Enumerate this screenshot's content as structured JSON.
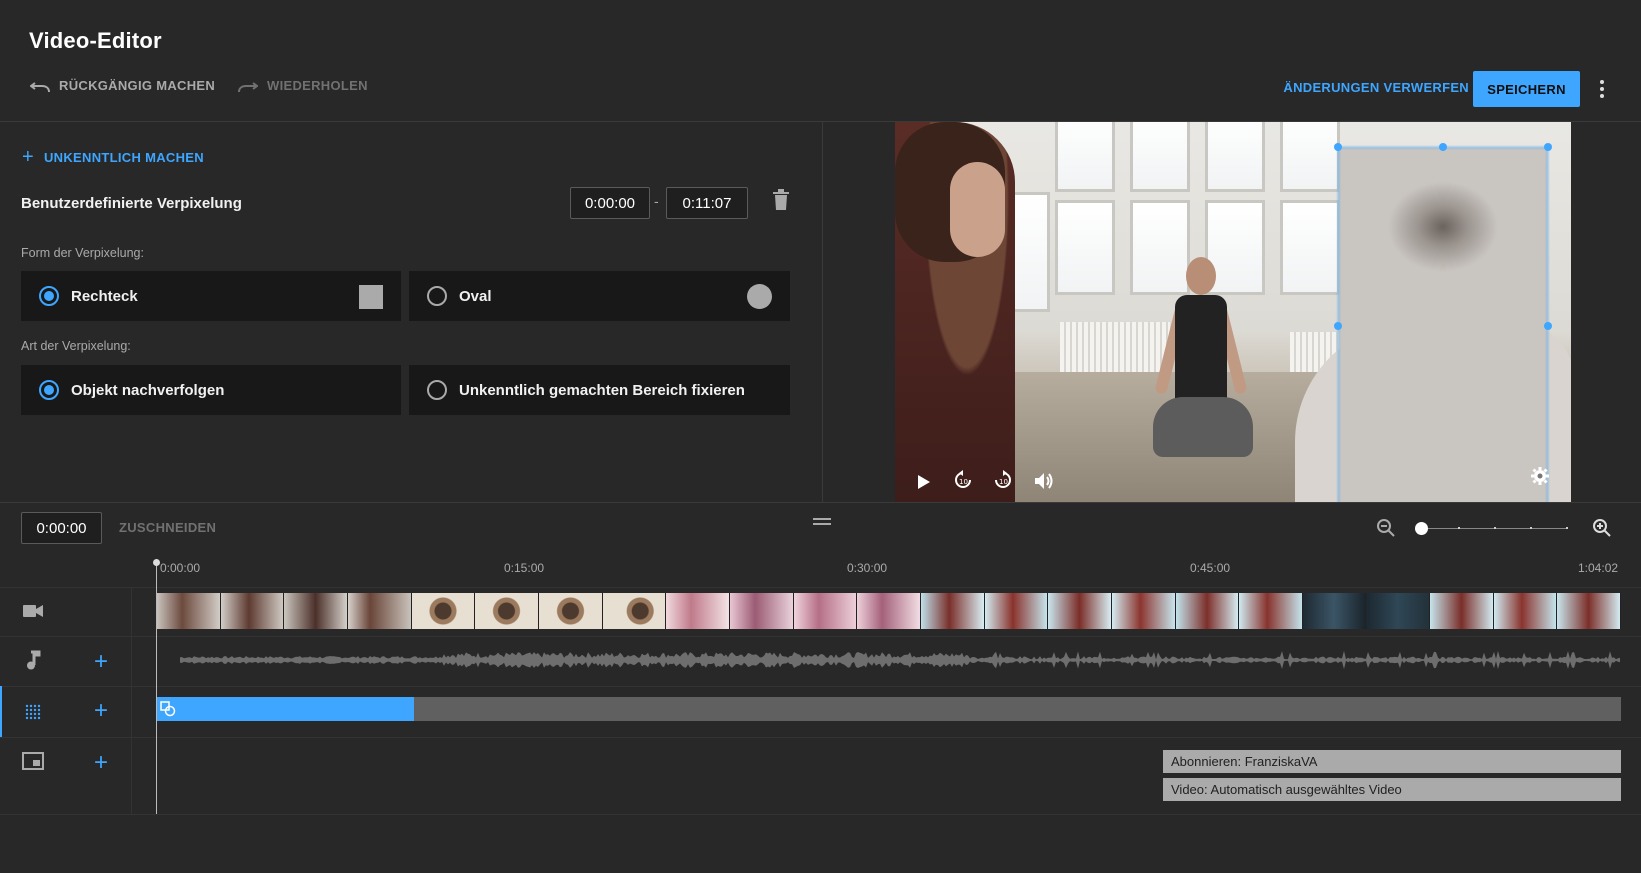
{
  "header": {
    "title": "Video-Editor",
    "undo_label": "RÜCKGÄNGIG MACHEN",
    "redo_label": "WIEDERHOLEN",
    "discard_label": "ÄNDERUNGEN VERWERFEN",
    "save_label": "SPEICHERN"
  },
  "blur_panel": {
    "add_label": "UNKENNTLICH MACHEN",
    "item_name": "Benutzerdefinierte Verpixelung",
    "start_time": "0:00:00",
    "dash": "-",
    "end_time": "0:11:07",
    "shape_label": "Form der Verpixelung:",
    "shape_options": [
      {
        "label": "Rechteck",
        "selected": true
      },
      {
        "label": "Oval",
        "selected": false
      }
    ],
    "type_label": "Art der Verpixelung:",
    "type_options": [
      {
        "label": "Objekt nachverfolgen",
        "selected": true
      },
      {
        "label": "Unkenntlich gemachten Bereich fixieren",
        "selected": false
      }
    ]
  },
  "timeline": {
    "current_time": "0:00:00",
    "trim_label": "ZUSCHNEIDEN",
    "ruler": [
      "0:00:00",
      "0:15:00",
      "0:30:00",
      "0:45:00",
      "1:04:02"
    ],
    "blur_segment_fraction": 0.176,
    "end_screen_items": [
      "Abonnieren: FranziskaVA",
      "Video: Automatisch ausgewähltes Video"
    ]
  },
  "colors": {
    "accent": "#3ea6ff",
    "background": "#282828",
    "panel": "#181818"
  },
  "icons": {
    "undo": "undo-icon",
    "redo": "redo-icon",
    "more": "more-vert-icon",
    "add": "plus-icon",
    "trash": "trash-icon",
    "play": "play-icon",
    "replay10": "replay-10-icon",
    "forward10": "forward-10-icon",
    "volume": "volume-icon",
    "settings": "gear-icon",
    "zoom_out": "zoom-out-icon",
    "zoom_in": "zoom-in-icon",
    "video_track": "video-camera-icon",
    "audio_track": "music-note-icon",
    "blur_track": "blur-grid-icon",
    "endscreen_track": "end-screen-icon"
  }
}
